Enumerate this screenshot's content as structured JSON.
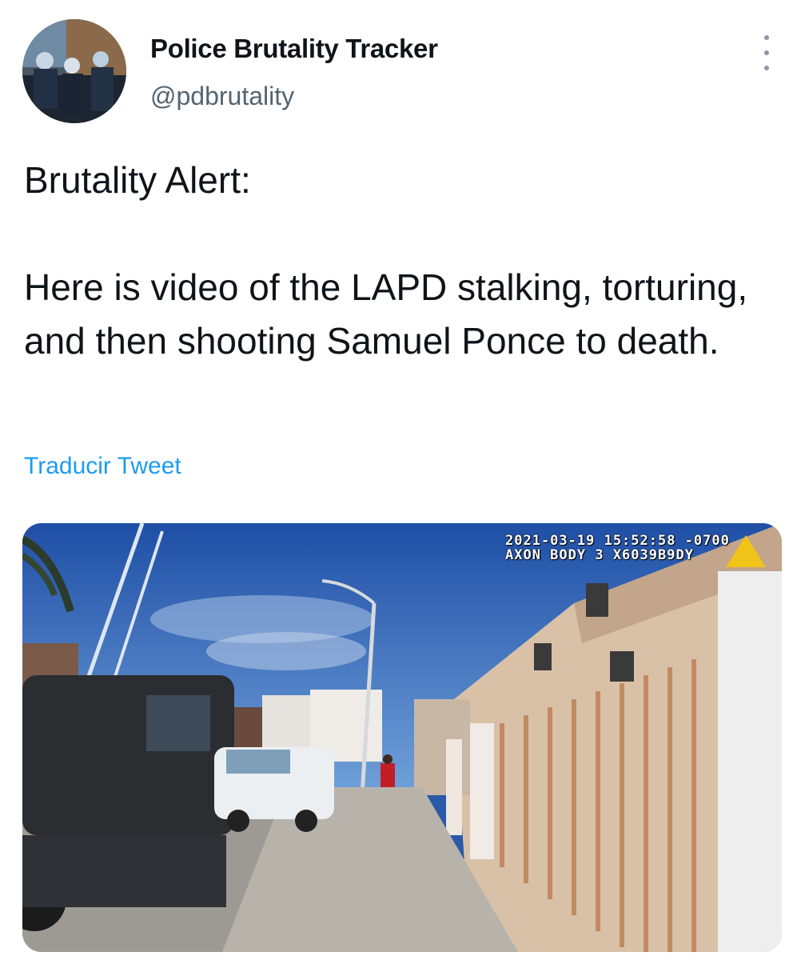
{
  "profile": {
    "display_name": "Police Brutality Tracker",
    "handle": "@pdbrutality"
  },
  "tweet": {
    "text": "Brutality Alert:\n\nHere is video of the LAPD stalking, torturing, and then shooting Samuel Ponce to death.",
    "translate_label": "Traducir Tweet"
  },
  "media": {
    "timestamp_line": "2021-03-19 15:52:58 -0700",
    "device_line": "AXON BODY 3 X6039B9DY"
  },
  "icons": {
    "more": "more-options-icon",
    "axon": "axon-logo-icon"
  },
  "colors": {
    "link": "#1d9bf0",
    "secondary_text": "#536471"
  }
}
